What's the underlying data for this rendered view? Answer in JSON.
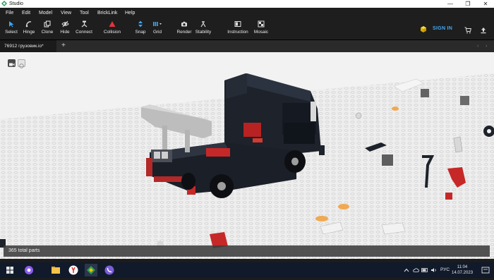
{
  "window": {
    "title": "Studio"
  },
  "menu": [
    "File",
    "Edit",
    "Model",
    "View",
    "Tool",
    "BrickLink",
    "Help"
  ],
  "toolbar": {
    "select": "Select",
    "hinge": "Hinge",
    "clone": "Clone",
    "hide": "Hide",
    "connect": "Connect",
    "collision": "Collision",
    "snap": "Snap",
    "grid": "Grid",
    "render": "Render",
    "stability": "Stability",
    "instruction": "Instruction",
    "mosaic": "Mosaic",
    "sign_in": "SIGN IN"
  },
  "tabs": {
    "active": "76912 грузовик.io*",
    "add": "+"
  },
  "status": {
    "parts": "365 total parts"
  },
  "taskbar": {
    "language": "РУС",
    "time": "11:04",
    "date": "14.07.2023"
  },
  "colors": {
    "accent_blue": "#3fa9f5",
    "collision_red": "#e0343e",
    "signin_cube": "#f2c200"
  }
}
